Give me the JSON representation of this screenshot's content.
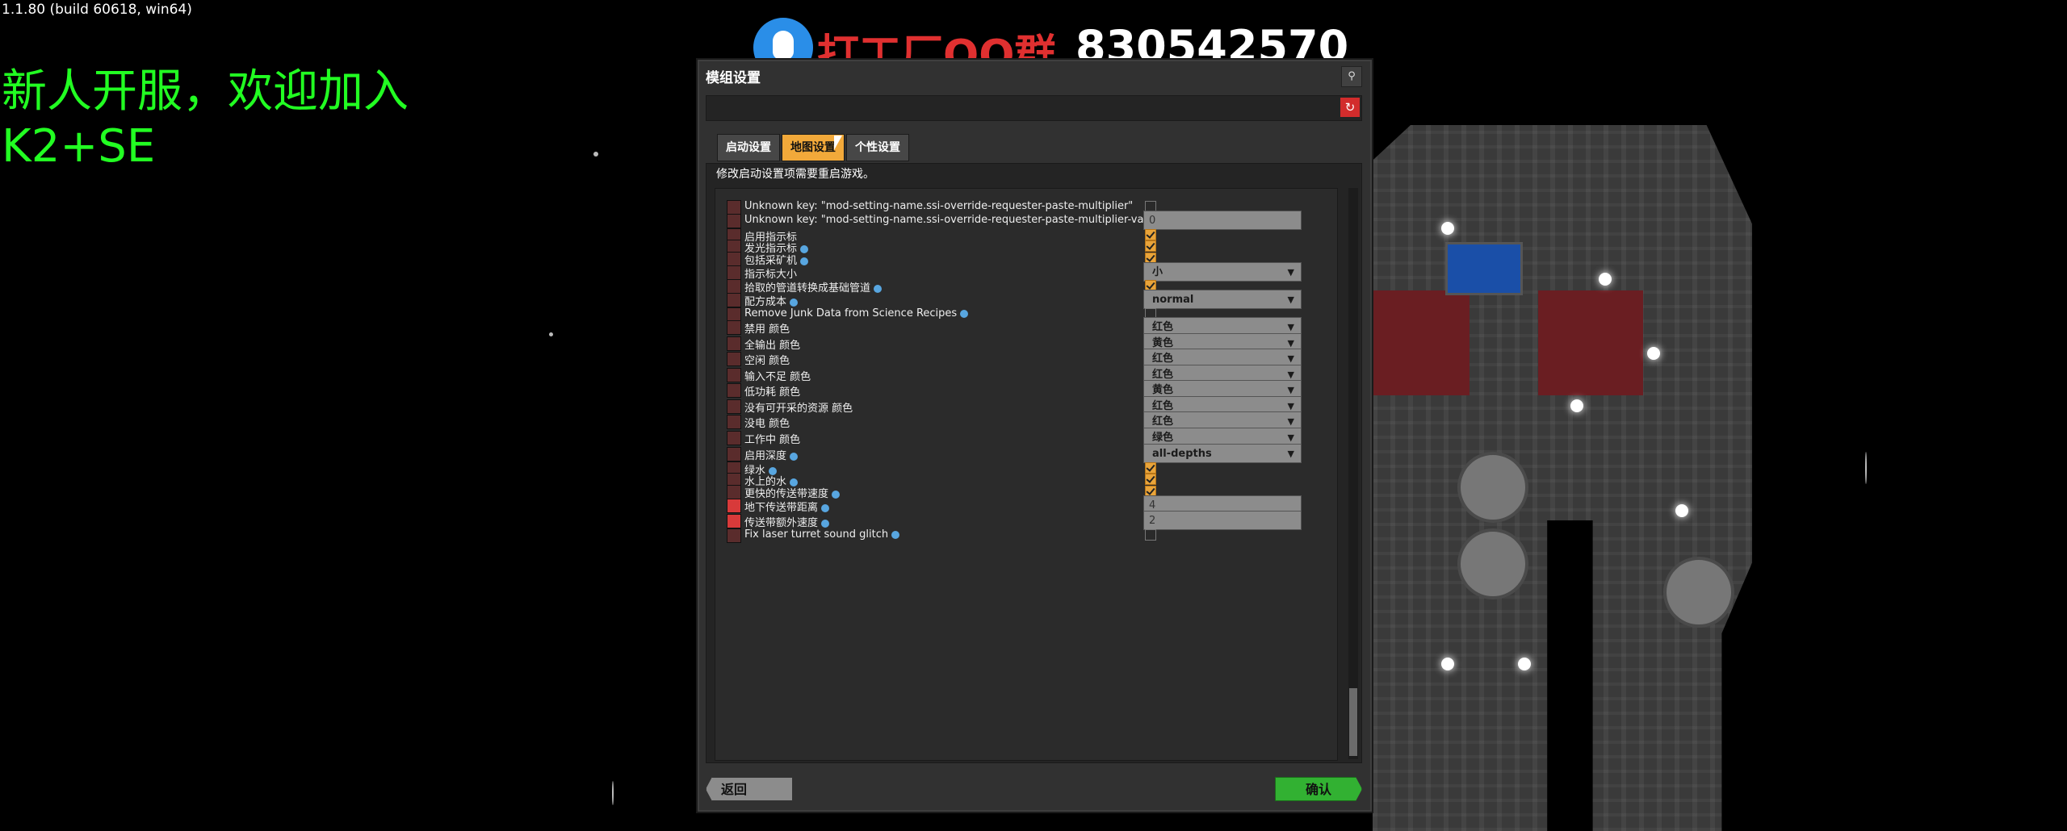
{
  "version_text": "1.1.80 (build 60618, win64)",
  "banner": {
    "line1": "新人开服，欢迎加入",
    "line2": "K2+SE"
  },
  "qq": {
    "red_text": "打工厂QQ群",
    "number": "830542570"
  },
  "dialog": {
    "title": "模组设置",
    "search_icon": "search-icon",
    "reset_icon": "reset-icon",
    "tabs": [
      {
        "label": "启动设置"
      },
      {
        "label": "地图设置"
      },
      {
        "label": "个性设置"
      }
    ],
    "active_tab": "地图设置",
    "restart_note": "修改启动设置项需要重启游戏。",
    "rows": [
      {
        "label": "Unknown key: \"mod-setting-name.ssi-override-requester-paste-multiplier\"",
        "control": "checkbox",
        "checked": false
      },
      {
        "label": "Unknown key: \"mod-setting-name.ssi-override-requester-paste-multiplier-value\"",
        "control": "text",
        "value": "0"
      },
      {
        "label": "启用指示标",
        "control": "checkbox",
        "checked": true
      },
      {
        "label": "发光指示标",
        "control": "checkbox",
        "checked": true,
        "info": true
      },
      {
        "label": "包括采矿机",
        "control": "checkbox",
        "checked": true,
        "info": true
      },
      {
        "label": "指示标大小",
        "control": "dropdown",
        "value": "小"
      },
      {
        "label": "拾取的管道转换成基础管道",
        "control": "checkbox",
        "checked": true,
        "info": true
      },
      {
        "label": "配方成本",
        "control": "dropdown",
        "value": "normal",
        "info": true
      },
      {
        "label": "Remove Junk Data from Science Recipes",
        "control": "checkbox",
        "checked": false,
        "info": true
      },
      {
        "label": "禁用 颜色",
        "control": "dropdown",
        "value": "红色"
      },
      {
        "label": "全输出 颜色",
        "control": "dropdown",
        "value": "黄色"
      },
      {
        "label": "空闲 颜色",
        "control": "dropdown",
        "value": "红色"
      },
      {
        "label": "输入不足 颜色",
        "control": "dropdown",
        "value": "红色"
      },
      {
        "label": "低功耗 颜色",
        "control": "dropdown",
        "value": "黄色"
      },
      {
        "label": "没有可开采的资源 颜色",
        "control": "dropdown",
        "value": "红色"
      },
      {
        "label": "没电 颜色",
        "control": "dropdown",
        "value": "红色"
      },
      {
        "label": "工作中 颜色",
        "control": "dropdown",
        "value": "绿色"
      },
      {
        "label": "启用深度",
        "control": "dropdown",
        "value": "all-depths",
        "info": true
      },
      {
        "label": "绿水",
        "control": "checkbox",
        "checked": true,
        "info": true
      },
      {
        "label": "水上的水",
        "control": "checkbox",
        "checked": true,
        "info": true
      },
      {
        "label": "更快的传送带速度",
        "control": "checkbox",
        "checked": true,
        "info": true
      },
      {
        "label": "地下传送带距离",
        "control": "text",
        "value": "4",
        "info": true,
        "bright_icon": true
      },
      {
        "label": "传送带额外速度",
        "control": "text",
        "value": "2",
        "info": true,
        "bright_icon": true
      },
      {
        "label": "Fix laser turret sound glitch",
        "control": "checkbox",
        "checked": false,
        "info": true
      }
    ],
    "back_label": "返回",
    "confirm_label": "确认"
  },
  "colors": {
    "accent_orange": "#f2a93a",
    "confirm_green": "#32b132",
    "banner_green": "#22ff22",
    "qq_red": "#e03030"
  }
}
